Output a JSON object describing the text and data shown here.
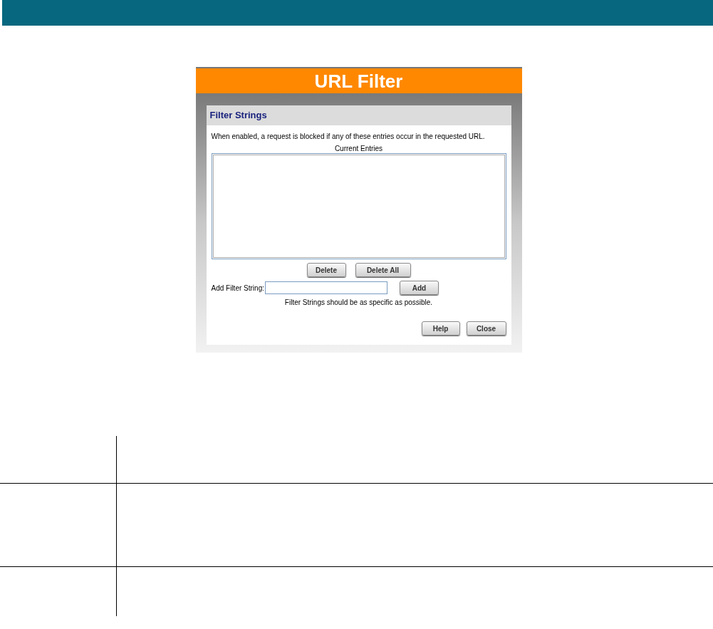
{
  "dialog": {
    "title": "URL Filter",
    "section_title": "Filter Strings",
    "description": "When enabled, a request is blocked if any of these entries occur in the requested URL.",
    "list_label": "Current Entries",
    "list_buttons": [
      "Delete",
      "Delete All"
    ],
    "add_field": {
      "label": "Add Filter String:",
      "button": "Add"
    },
    "hint": "Filter Strings should be as specific as possible.",
    "footer_buttons": [
      "Help",
      "Close"
    ]
  }
}
